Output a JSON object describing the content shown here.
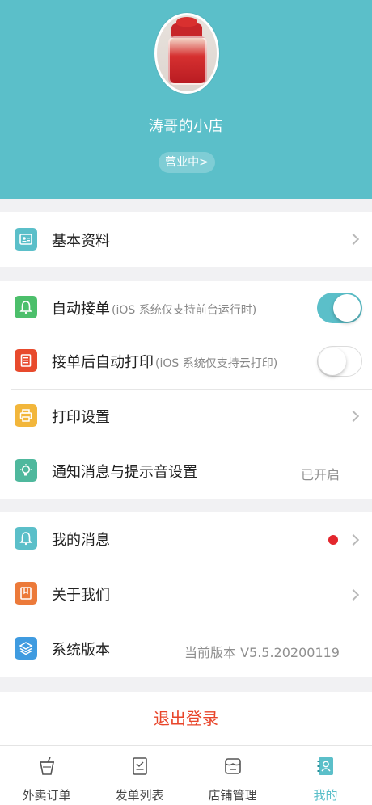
{
  "header": {
    "store_name": "涛哥的小店",
    "status": "营业中>"
  },
  "profile_section": {
    "basic_info": "基本资料"
  },
  "settings_section": {
    "auto_accept": {
      "label": "自动接单",
      "note": "(iOS 系统仅支持前台运行时)",
      "enabled": true
    },
    "auto_print": {
      "label": "接单后自动打印",
      "note": "(iOS 系统仅支持云打印)",
      "enabled": false
    },
    "print_settings": "打印设置",
    "notification": {
      "label": "通知消息与提示音设置",
      "value": "已开启"
    }
  },
  "about_section": {
    "my_messages": "我的消息",
    "about_us": "关于我们",
    "version": {
      "label": "系统版本",
      "value": "当前版本 V5.5.20200119"
    }
  },
  "logout": "退出登录",
  "tabbar": {
    "tabs": [
      {
        "label": "外卖订单",
        "icon": "drink-cup-icon",
        "active": false
      },
      {
        "label": "发单列表",
        "icon": "document-icon",
        "active": false
      },
      {
        "label": "店铺管理",
        "icon": "store-icon",
        "active": false
      },
      {
        "label": "我的",
        "icon": "contact-book-icon",
        "active": true
      }
    ]
  },
  "colors": {
    "brand_teal": "#5bbfc9",
    "logout_red": "#e8452a",
    "badge_red": "#e3262d"
  }
}
